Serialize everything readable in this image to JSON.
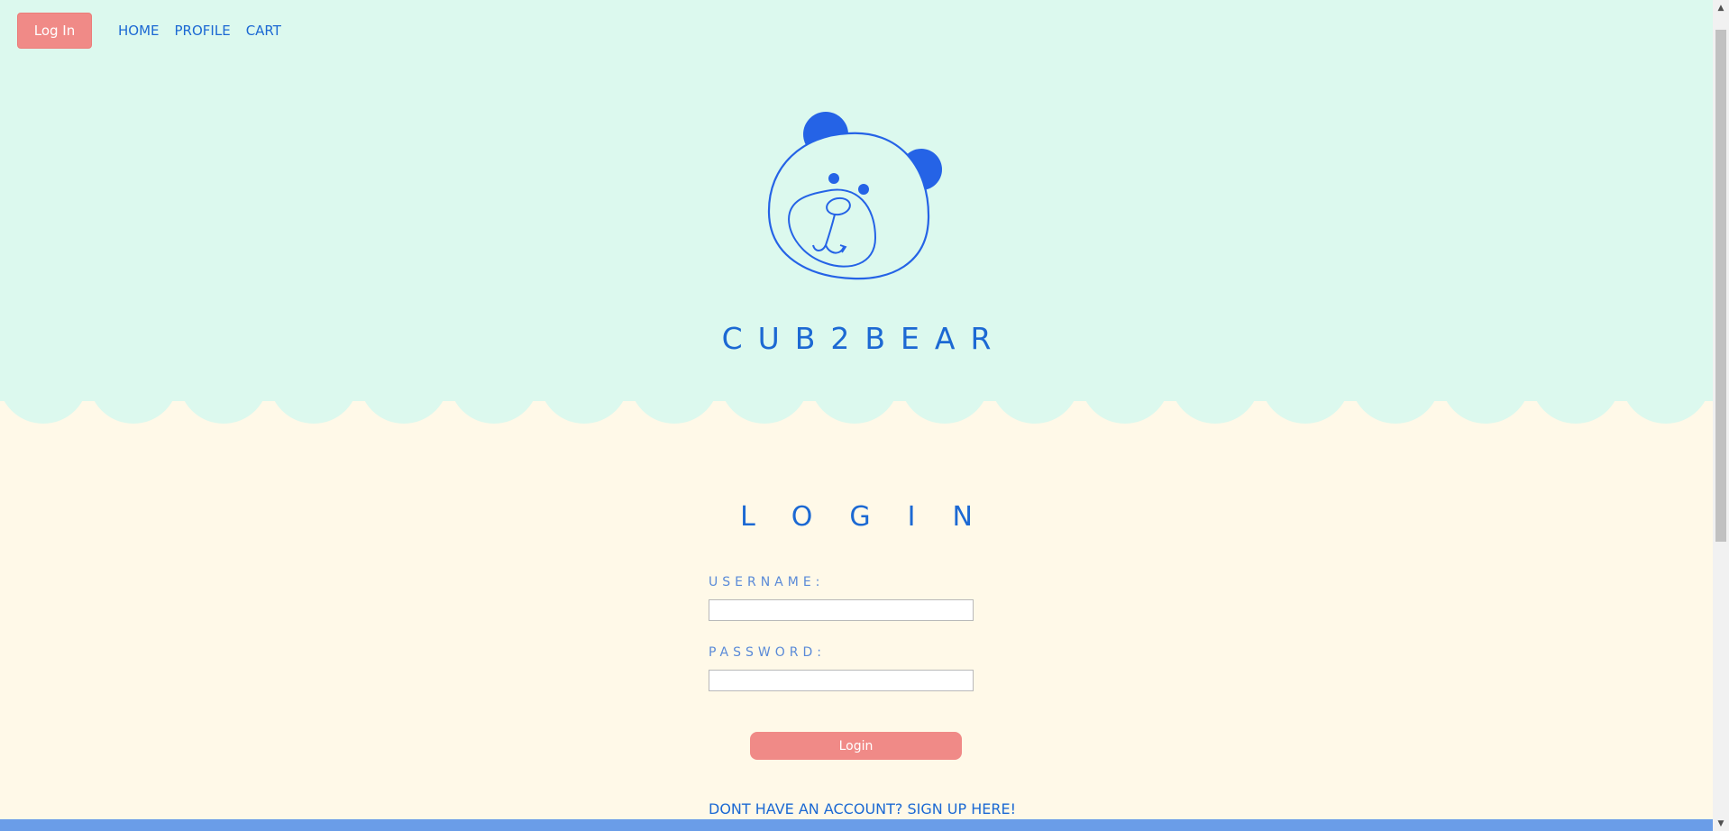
{
  "nav": {
    "login_button": "Log In",
    "links": [
      "HOME",
      "PROFILE",
      "CART"
    ]
  },
  "brand": {
    "name": "CUB2BEAR"
  },
  "login": {
    "title": "LOGIN",
    "username_label": "USERNAME:",
    "password_label": "PASSWORD:",
    "submit_label": "Login",
    "signup_text": "DONT HAVE AN ACCOUNT? SIGN UP HERE!"
  },
  "icons": {
    "logo": "bear-face-icon",
    "scroll_up": "chevron-up-icon",
    "scroll_down": "chevron-down-icon"
  },
  "colors": {
    "hero_bg": "#dcf9ee",
    "page_bg": "#fff9e8",
    "accent_blue": "#1c69d3",
    "button_coral": "#f08a87",
    "footer_blue": "#6a9de8"
  }
}
